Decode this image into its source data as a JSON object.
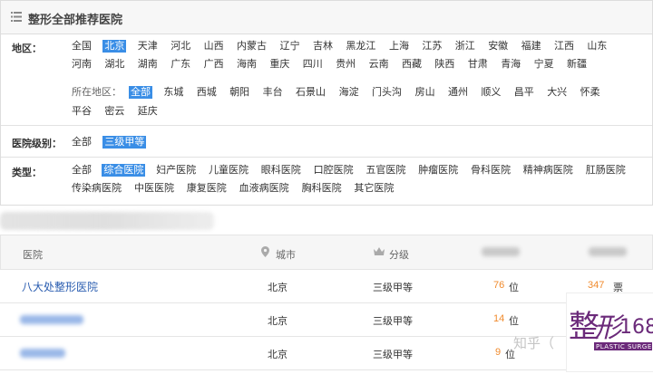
{
  "header": {
    "title": "整形全部推荐医院",
    "icon": "list-icon"
  },
  "region": {
    "label": "地区：",
    "row1": [
      "全国",
      "北京",
      "天津",
      "河北",
      "山西",
      "内蒙古",
      "辽宁",
      "吉林",
      "黑龙江",
      "上海",
      "江苏",
      "浙江",
      "安徽",
      "福建",
      "江西",
      "山东"
    ],
    "row2": [
      "河南",
      "湖北",
      "湖南",
      "广东",
      "广西",
      "海南",
      "重庆",
      "四川",
      "贵州",
      "云南",
      "西藏",
      "陕西",
      "甘肃",
      "青海",
      "宁夏",
      "新疆"
    ],
    "selected": "北京",
    "sub_label": "所在地区：",
    "sub_row1": [
      "全部",
      "东城",
      "西城",
      "朝阳",
      "丰台",
      "石景山",
      "海淀",
      "门头沟",
      "房山",
      "通州",
      "顺义",
      "昌平",
      "大兴",
      "怀柔"
    ],
    "sub_row2": [
      "平谷",
      "密云",
      "延庆"
    ],
    "sub_selected": "全部"
  },
  "level": {
    "label": "医院级别：",
    "options": [
      "全部",
      "三级甲等"
    ],
    "selected": "三级甲等"
  },
  "type": {
    "label": "类型：",
    "row1": [
      "全部",
      "综合医院",
      "妇产医院",
      "儿童医院",
      "眼科医院",
      "口腔医院",
      "五官医院",
      "肿瘤医院",
      "骨科医院",
      "精神病医院",
      "肛肠医院"
    ],
    "row2": [
      "传染病医院",
      "中医医院",
      "康复医院",
      "血液病医院",
      "胸科医院",
      "其它医院"
    ],
    "selected": "综合医院"
  },
  "table": {
    "columns": {
      "name": "医院",
      "city": "城市",
      "level": "分级"
    },
    "rows": [
      {
        "name": "八大处整形医院",
        "city": "北京",
        "level": "三级甲等",
        "rank": "76",
        "rank_unit": "位",
        "votes": "347",
        "votes_unit": "票"
      },
      {
        "name": "",
        "city": "北京",
        "level": "三级甲等",
        "rank": "14",
        "rank_unit": "位",
        "votes": "",
        "votes_unit": ""
      },
      {
        "name": "",
        "city": "北京",
        "level": "三级甲等",
        "rank": "9",
        "rank_unit": "位",
        "votes": "",
        "votes_unit": ""
      }
    ]
  },
  "watermark": "知乎（",
  "logo": {
    "big": "整形",
    "num": "168",
    "sub": "PLASTIC SURGERY"
  },
  "colors": {
    "accent": "#3a8ee6",
    "link": "#2a5db0",
    "rank": "#f08a2c",
    "logo_purple": "#6b2a7a"
  }
}
